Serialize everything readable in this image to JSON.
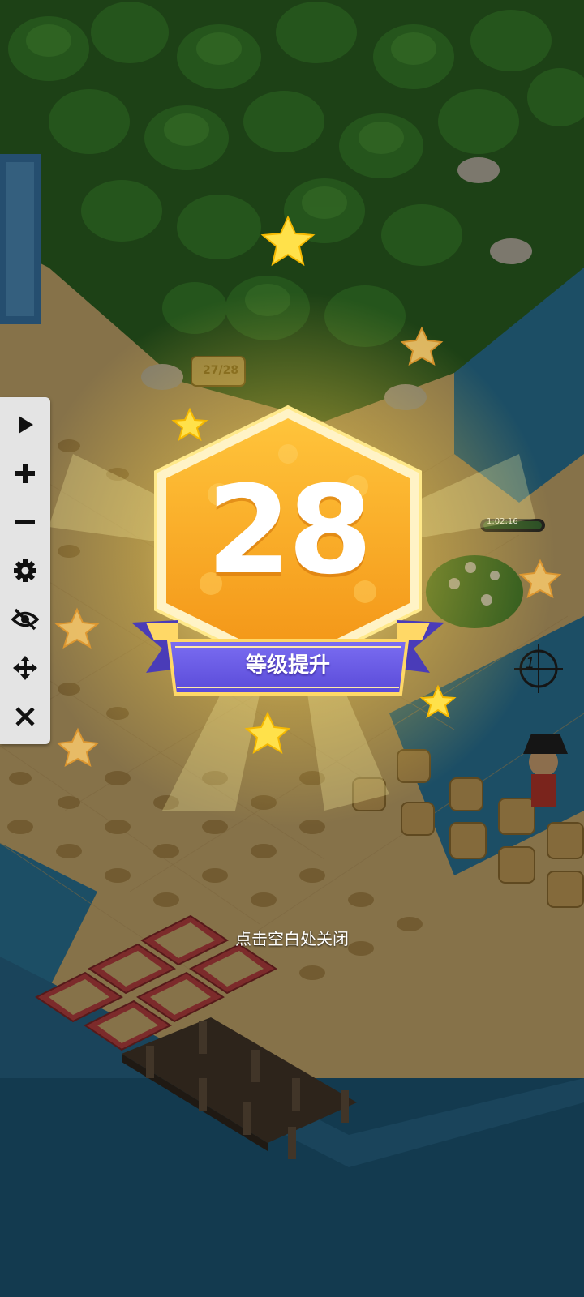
{
  "toolbar": {
    "items": [
      {
        "icon": "play-icon"
      },
      {
        "icon": "plus-icon"
      },
      {
        "icon": "minus-icon"
      },
      {
        "icon": "gear-icon"
      },
      {
        "icon": "eye-slash-icon"
      },
      {
        "icon": "move-icon"
      },
      {
        "icon": "close-icon"
      }
    ]
  },
  "level_up": {
    "level": "28",
    "label": "等级提升"
  },
  "hint": {
    "close_text": "点击空白处关闭"
  },
  "scene": {
    "plot_counter": "27/28",
    "timer": "1:02:16",
    "crosshair_number": "1"
  },
  "colors": {
    "badge_orange": "#f7a51c",
    "badge_border": "#fff2c2",
    "ribbon_purple": "#6a5ce8",
    "sand": "#d9b877",
    "sea": "#2a6f93",
    "star_yellow": "#ffe14a"
  }
}
